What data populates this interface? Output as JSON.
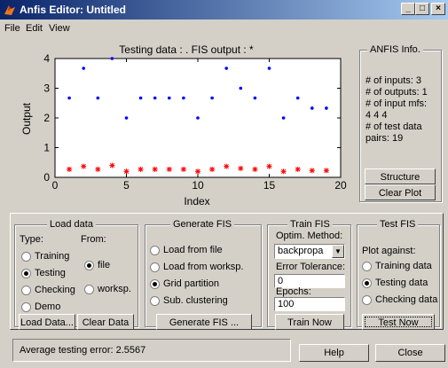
{
  "window": {
    "title": "Anfis Editor: Untitled",
    "minimize": "_",
    "maximize": "□",
    "close": "×"
  },
  "menu": [
    "File",
    "Edit",
    "View"
  ],
  "plot": {
    "title": "Testing data : .   FIS output : *",
    "xlabel": "Index",
    "ylabel": "Output",
    "xticks": [
      "0",
      "5",
      "10",
      "15",
      "20"
    ],
    "yticks": [
      "0",
      "1",
      "2",
      "3",
      "4"
    ]
  },
  "chart_data": {
    "type": "scatter",
    "xlim": [
      0,
      20
    ],
    "ylim": [
      0,
      4
    ],
    "series": [
      {
        "marker": "dot",
        "color": "#0000ff",
        "x": [
          1,
          2,
          3,
          4,
          5,
          6,
          7,
          8,
          9,
          10,
          11,
          12,
          13,
          14,
          15,
          16,
          17,
          18,
          19
        ],
        "y": [
          2.67,
          3.67,
          2.67,
          4.0,
          2.0,
          2.67,
          2.67,
          2.67,
          2.67,
          2.0,
          2.67,
          3.67,
          3.0,
          2.67,
          3.67,
          2.0,
          2.67,
          2.33,
          2.33
        ]
      },
      {
        "marker": "star",
        "color": "#ff0000",
        "x": [
          1,
          2,
          3,
          4,
          5,
          6,
          7,
          8,
          9,
          10,
          11,
          12,
          13,
          14,
          15,
          16,
          17,
          18,
          19
        ],
        "y": [
          0.27,
          0.37,
          0.27,
          0.4,
          0.2,
          0.27,
          0.27,
          0.27,
          0.27,
          0.2,
          0.27,
          0.37,
          0.3,
          0.27,
          0.37,
          0.2,
          0.27,
          0.23,
          0.23
        ]
      }
    ]
  },
  "anfis_info": {
    "title": "ANFIS Info.",
    "lines": [
      "# of inputs: 3",
      "# of outputs: 1",
      "# of input mfs:",
      "4  4  4",
      "# of test data",
      "pairs: 19"
    ],
    "structure_button": "Structure",
    "clear_plot_button": "Clear Plot"
  },
  "load_data": {
    "title": "Load data",
    "type_label": "Type:",
    "from_label": "From:",
    "types": [
      "Training",
      "Testing",
      "Checking",
      "Demo"
    ],
    "selected_type": "Testing",
    "sources": [
      "file",
      "worksp."
    ],
    "selected_source": "file",
    "load_button": "Load Data...",
    "clear_button": "Clear Data"
  },
  "generate_fis": {
    "title": "Generate FIS",
    "options": [
      "Load from file",
      "Load from worksp.",
      "Grid partition",
      "Sub. clustering"
    ],
    "selected": "Grid partition",
    "button": "Generate FIS ..."
  },
  "train_fis": {
    "title": "Train FIS",
    "method_label": "Optim. Method:",
    "method_value": "backpropa",
    "tolerance_label": "Error Tolerance:",
    "tolerance_value": "0",
    "epochs_label": "Epochs:",
    "epochs_value": "100",
    "button": "Train Now"
  },
  "test_fis": {
    "title": "Test FIS",
    "plot_against_label": "Plot against:",
    "options": [
      "Training data",
      "Testing data",
      "Checking data"
    ],
    "selected": "Testing data",
    "button": "Test Now"
  },
  "status": {
    "message": "Average testing error: 2.5567",
    "help_button": "Help",
    "close_button": "Close"
  }
}
